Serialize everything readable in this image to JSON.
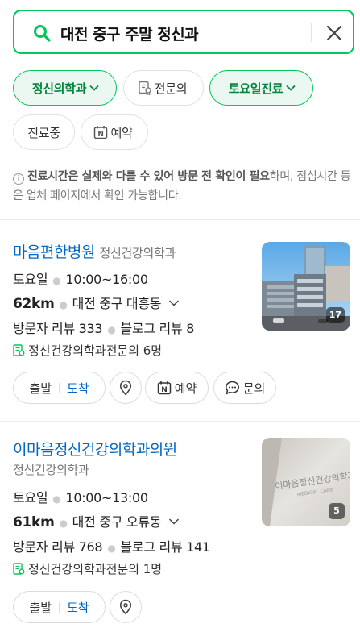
{
  "search": {
    "query": "대전 중구 주말 정신과"
  },
  "filters": {
    "chip1": "정신의학과",
    "chip2": "전문의",
    "chip3": "토요일진료",
    "chip4": "진료중",
    "chip5": "예약"
  },
  "notice": {
    "bold": "진료시간은 실제와 다를 수 있어 방문 전 확인이 필요",
    "rest": "하며, 점심시간 등은 업체 페이지에서 확인 가능합니다."
  },
  "results": [
    {
      "name": "마음편한병원",
      "category": "정신건강의학과",
      "day": "토요일",
      "hours": "10:00~16:00",
      "distance": "62km",
      "address": "대전 중구 대흥동",
      "visitor_reviews": "방문자 리뷰 333",
      "blog_reviews": "블로그 리뷰 8",
      "specialists": "정신건강의학과전문의 6명",
      "photo_count": "17",
      "depart": "출발",
      "arrive": "도착",
      "reserve": "예약",
      "inquiry": "문의"
    },
    {
      "name": "이마음정신건강의학과의원",
      "category": "정신건강의학과",
      "day": "토요일",
      "hours": "10:00~13:00",
      "distance": "61km",
      "address": "대전 중구 오류동",
      "visitor_reviews": "방문자 리뷰 768",
      "blog_reviews": "블로그 리뷰 141",
      "specialists": "정신건강의학과전문의 1명",
      "photo_count": "5",
      "sign_text": "이마음정신건강의학과",
      "sign_sub": "MEDICAL CARE",
      "depart": "출발",
      "arrive": "도착"
    }
  ],
  "colors": {
    "accent": "#03c75a",
    "link": "#0068c3",
    "chip_active_bg": "#ebf8f1",
    "chip_active_text": "#08843f"
  }
}
